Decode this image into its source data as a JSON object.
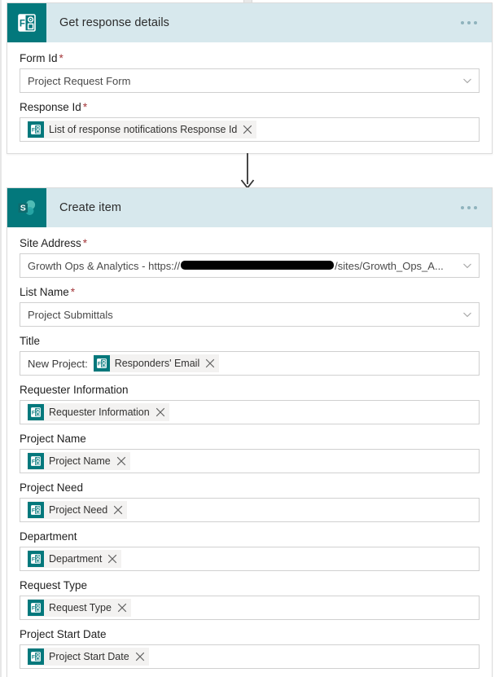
{
  "colors": {
    "header_bg": "#d7e8ed",
    "app_icon_bg": "#03787c",
    "required_asterisk": "#a4373a",
    "token_bg": "#f3f2f1",
    "card_border": "#dcdcdc",
    "arrow": "#333333"
  },
  "cards": [
    {
      "id": "get-response-details",
      "title": "Get response details",
      "icon": "microsoft-forms-icon",
      "menu": "...",
      "fields": [
        {
          "label": "Form Id",
          "required": true,
          "type": "dropdown",
          "value": "Project Request Form"
        },
        {
          "label": "Response Id",
          "required": true,
          "type": "token",
          "token": "List of response notifications Response Id"
        }
      ]
    },
    {
      "id": "create-item",
      "title": "Create item",
      "icon": "sharepoint-icon",
      "menu": "...",
      "fields": [
        {
          "label": "Site Address",
          "required": true,
          "type": "dropdown-redacted",
          "value_prefix": "Growth Ops & Analytics - https://",
          "value_suffix": "/sites/Growth_Ops_A..."
        },
        {
          "label": "List Name",
          "required": true,
          "type": "dropdown",
          "value": "Project Submittals"
        },
        {
          "label": "Title",
          "required": false,
          "type": "token-with-prefix",
          "prefix": "New Project:",
          "token": "Responders' Email"
        },
        {
          "label": "Requester Information",
          "required": false,
          "type": "token",
          "token": "Requester Information"
        },
        {
          "label": "Project Name",
          "required": false,
          "type": "token",
          "token": "Project Name"
        },
        {
          "label": "Project Need",
          "required": false,
          "type": "token",
          "token": "Project Need"
        },
        {
          "label": "Department",
          "required": false,
          "type": "token",
          "token": "Department"
        },
        {
          "label": "Request Type",
          "required": false,
          "type": "token",
          "token": "Request Type"
        },
        {
          "label": "Project Start Date",
          "required": false,
          "type": "token",
          "token": "Project Start Date"
        }
      ]
    }
  ]
}
